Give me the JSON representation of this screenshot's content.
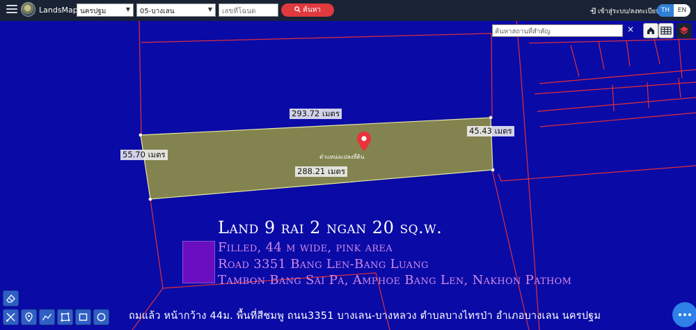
{
  "app": {
    "brand": "LandsMaps"
  },
  "search": {
    "province_value": "นครปฐม",
    "district_value": "05-บางเลน",
    "deed_placeholder": "เลขที่โฉนด",
    "search_label": "ค้นหา"
  },
  "header": {
    "login_label": "เข้าสู่ระบบ/ลงทะเบียน",
    "lang_th": "TH",
    "lang_en": "EN"
  },
  "map_tools": {
    "place_search_placeholder": "ค้นหาสถานที่สำคัญ",
    "clear_symbol": "×"
  },
  "measurements": {
    "top": "293.72 เมตร",
    "right": "45.43 เมตร",
    "left": "55.70 เมตร",
    "bottom": "288.21 เมตร"
  },
  "parcel": {
    "pin_label": "ตำแหน่งแปลงที่ดิน",
    "fill_color": "#8a8a4a"
  },
  "overlay": {
    "title": "Land 9 rai 2 ngan 20 sq.w.",
    "filled": "Filled, 44 m wide, pink area",
    "road": "Road 3351 Bang Len-Bang Luang",
    "tambon": "Tambon Bang Sai Pa, Amphoe Bang Len, Nakhon Pathom",
    "thai_caption": "ถมแล้ว หน้ากว้าง 44ม. พื้นที่สีชมพู ถนน3351 บางเลน-บางหลวง  ตำบลบางไทรป่า  อำเภอบางเลน นครปฐม"
  },
  "colors": {
    "map_background": "#0a0aa6",
    "parcel_lines": "#e0303a",
    "topbar": "#1a2333",
    "search_button": "#e0393e",
    "lang_active": "#2f7fd6"
  }
}
